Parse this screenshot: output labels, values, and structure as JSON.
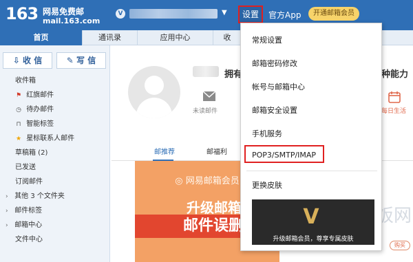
{
  "header": {
    "logo_number": "163",
    "logo_name": "网易免费邮",
    "logo_domain": "mail.163.com",
    "vip_badge": "V",
    "caret": "▼",
    "settings_label": "设置",
    "app_label": "官方App",
    "vip_button_label": "开通邮箱会员"
  },
  "nav": {
    "tabs": [
      {
        "label": "首页"
      },
      {
        "label": "通讯录"
      },
      {
        "label": "应用中心"
      },
      {
        "label": "收"
      }
    ]
  },
  "sidebar": {
    "receive_label": "收 信",
    "write_label": "写 信",
    "folders": [
      {
        "label": "收件箱"
      },
      {
        "label": "红旗邮件"
      },
      {
        "label": "待办邮件"
      },
      {
        "label": "智能标签"
      },
      {
        "label": "星标联系人邮件"
      },
      {
        "label": "草稿箱 (2)"
      },
      {
        "label": "已发送"
      },
      {
        "label": "订阅邮件"
      },
      {
        "label": "其他 3 个文件夹"
      },
      {
        "label": "邮件标签"
      },
      {
        "label": "邮箱中心"
      },
      {
        "label": "文件中心"
      }
    ]
  },
  "main": {
    "greeting": "拥有",
    "greeting_right": "种能力",
    "unread_label": "未读邮件",
    "daily_label": "每日生活",
    "subtabs": [
      {
        "label": "邮推荐"
      },
      {
        "label": "邮福利"
      }
    ],
    "banner_brand": "网易邮箱会员",
    "banner_line1": "升级邮箱会",
    "banner_line2": "邮件误删可"
  },
  "dropdown": {
    "items": [
      {
        "label": "常规设置"
      },
      {
        "label": "邮箱密码修改"
      },
      {
        "label": "帐号与邮箱中心"
      },
      {
        "label": "邮箱安全设置"
      },
      {
        "label": "手机服务"
      },
      {
        "label": "POP3/SMTP/IMAP"
      },
      {
        "label": "更换皮肤"
      }
    ],
    "promo_text": "升级邮箱会员，尊享专属皮肤"
  },
  "buy_label": "购买",
  "watermark_text": "卡饭网",
  "colors": {
    "brand_blue": "#2f6fb6",
    "highlight_red": "#e02020",
    "vip_gold": "#f7d36a",
    "banner_orange": "#f3a165"
  }
}
